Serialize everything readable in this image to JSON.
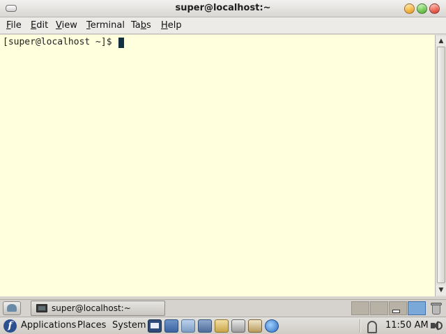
{
  "window": {
    "title": "super@localhost:~"
  },
  "menubar": {
    "items": [
      {
        "key": "F",
        "rest": "ile"
      },
      {
        "key": "E",
        "rest": "dit"
      },
      {
        "key": "V",
        "rest": "iew"
      },
      {
        "key": "T",
        "rest": "erminal"
      },
      {
        "pre": "Ta",
        "key": "b",
        "rest": "s"
      },
      {
        "key": "H",
        "rest": "elp"
      }
    ]
  },
  "terminal": {
    "prompt": "[super@localhost ~]$ ",
    "background": "#ffffdd"
  },
  "taskbar": {
    "window_button_label": "super@localhost:~",
    "workspace_count": 4,
    "active_workspace": 4
  },
  "panel": {
    "applications_label": "Applications",
    "places_label": "Places",
    "system_label": "System",
    "fedora_glyph": "f",
    "clock": "11:50 AM"
  }
}
